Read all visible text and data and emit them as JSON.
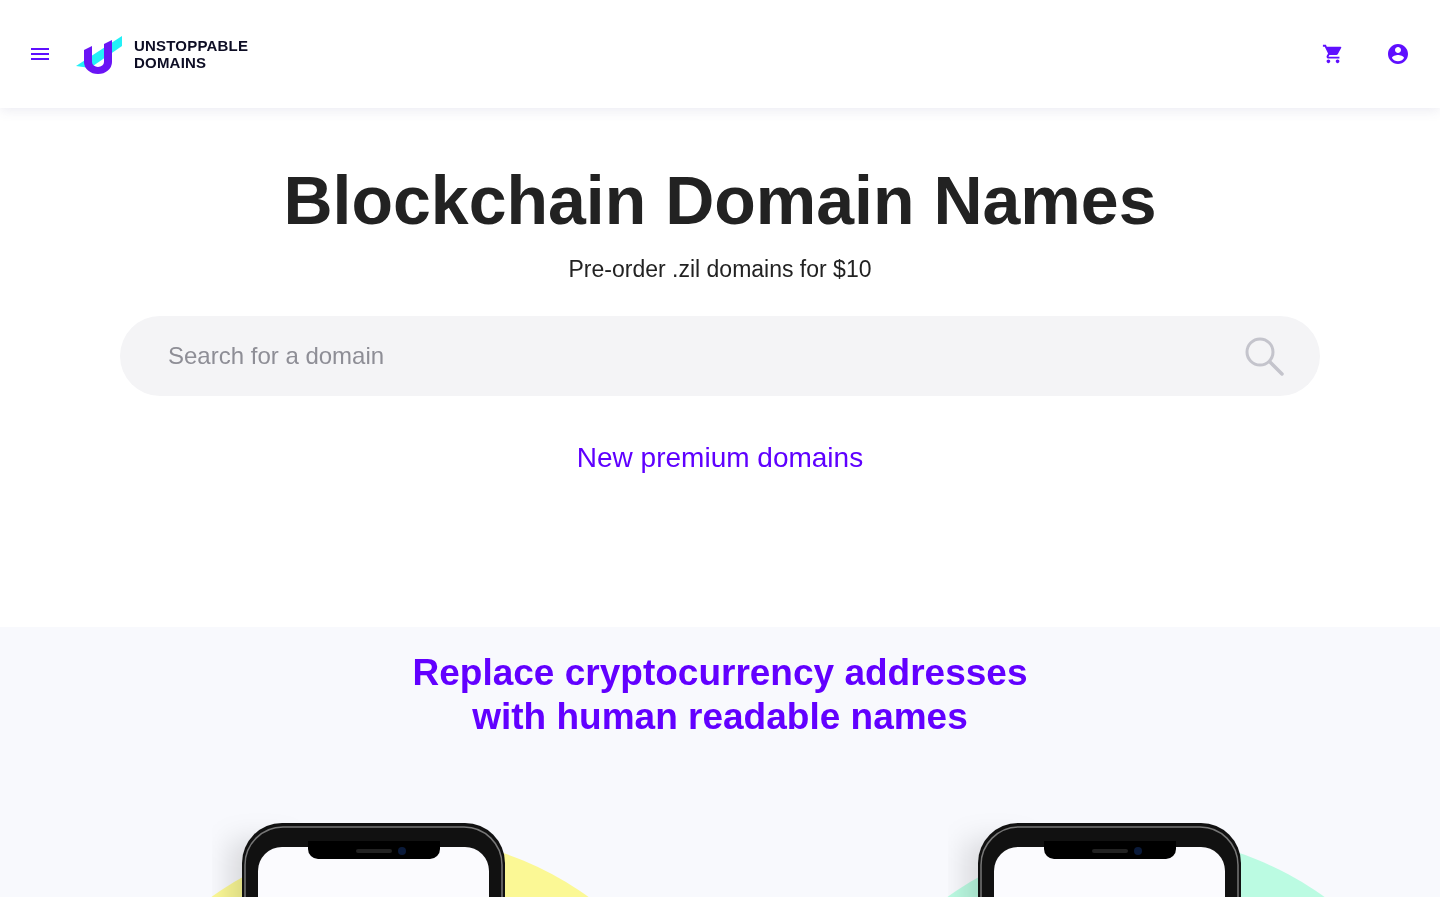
{
  "header": {
    "logo_lines": [
      "UNSTOPPABLE",
      "DOMAINS"
    ]
  },
  "hero": {
    "title": "Blockchain Domain Names",
    "subtitle": "Pre-order .zil domains for $10",
    "search": {
      "placeholder": "Search for a domain"
    },
    "link": "New premium domains"
  },
  "feature": {
    "heading_lines": [
      "Replace cryptocurrency addresses",
      "with human readable names"
    ]
  }
}
